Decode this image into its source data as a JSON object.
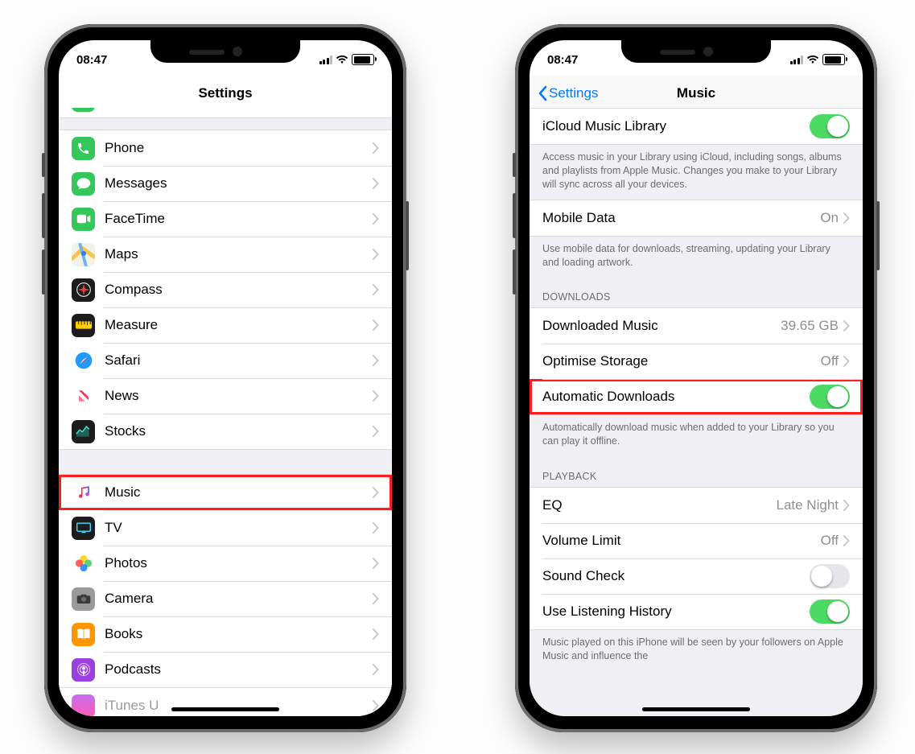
{
  "status": {
    "time": "08:47"
  },
  "left": {
    "title": "Settings",
    "groups": [
      {
        "items": [
          {
            "icon": "phone",
            "color": "#34c759",
            "label": "Phone"
          },
          {
            "icon": "messages",
            "color": "#34c759",
            "label": "Messages"
          },
          {
            "icon": "facetime",
            "color": "#34c759",
            "label": "FaceTime"
          },
          {
            "icon": "maps",
            "color": "#ffffff",
            "label": "Maps"
          },
          {
            "icon": "compass",
            "color": "#1c1c1e",
            "label": "Compass"
          },
          {
            "icon": "measure",
            "color": "#1c1c1e",
            "label": "Measure"
          },
          {
            "icon": "safari",
            "color": "#ffffff",
            "label": "Safari"
          },
          {
            "icon": "news",
            "color": "#ffffff",
            "label": "News"
          },
          {
            "icon": "stocks",
            "color": "#1c1c1e",
            "label": "Stocks"
          }
        ]
      },
      {
        "items": [
          {
            "icon": "music",
            "color": "#ffffff",
            "label": "Music",
            "highlight": true
          },
          {
            "icon": "tv",
            "color": "#1c1c1e",
            "label": "TV"
          },
          {
            "icon": "photos",
            "color": "#ffffff",
            "label": "Photos"
          },
          {
            "icon": "camera",
            "color": "#9a9a9a",
            "label": "Camera"
          },
          {
            "icon": "books",
            "color": "#ff9500",
            "label": "Books"
          },
          {
            "icon": "podcasts",
            "color": "#9b3fe0",
            "label": "Podcasts"
          }
        ]
      }
    ]
  },
  "right": {
    "back": "Settings",
    "title": "Music",
    "sections": [
      {
        "rows": [
          {
            "label": "iCloud Music Library",
            "type": "switch",
            "on": true
          }
        ],
        "footer": "Access music in your Library using iCloud, including songs, albums and playlists from Apple Music. Changes you make to your Library will sync across all your devices."
      },
      {
        "rows": [
          {
            "label": "Mobile Data",
            "type": "link",
            "value": "On"
          }
        ],
        "footer": "Use mobile data for downloads, streaming, updating your Library and loading artwork."
      },
      {
        "header": "DOWNLOADS",
        "rows": [
          {
            "label": "Downloaded Music",
            "type": "link",
            "value": "39.65 GB"
          },
          {
            "label": "Optimise Storage",
            "type": "link",
            "value": "Off"
          },
          {
            "label": "Automatic Downloads",
            "type": "switch",
            "on": true,
            "highlight": true
          }
        ],
        "footer": "Automatically download music when added to your Library so you can play it offline."
      },
      {
        "header": "PLAYBACK",
        "rows": [
          {
            "label": "EQ",
            "type": "link",
            "value": "Late Night"
          },
          {
            "label": "Volume Limit",
            "type": "link",
            "value": "Off"
          },
          {
            "label": "Sound Check",
            "type": "switch",
            "on": false
          },
          {
            "label": "Use Listening History",
            "type": "switch",
            "on": true
          }
        ],
        "footer": "Music played on this iPhone will be seen by your followers on Apple Music and influence the"
      }
    ]
  }
}
